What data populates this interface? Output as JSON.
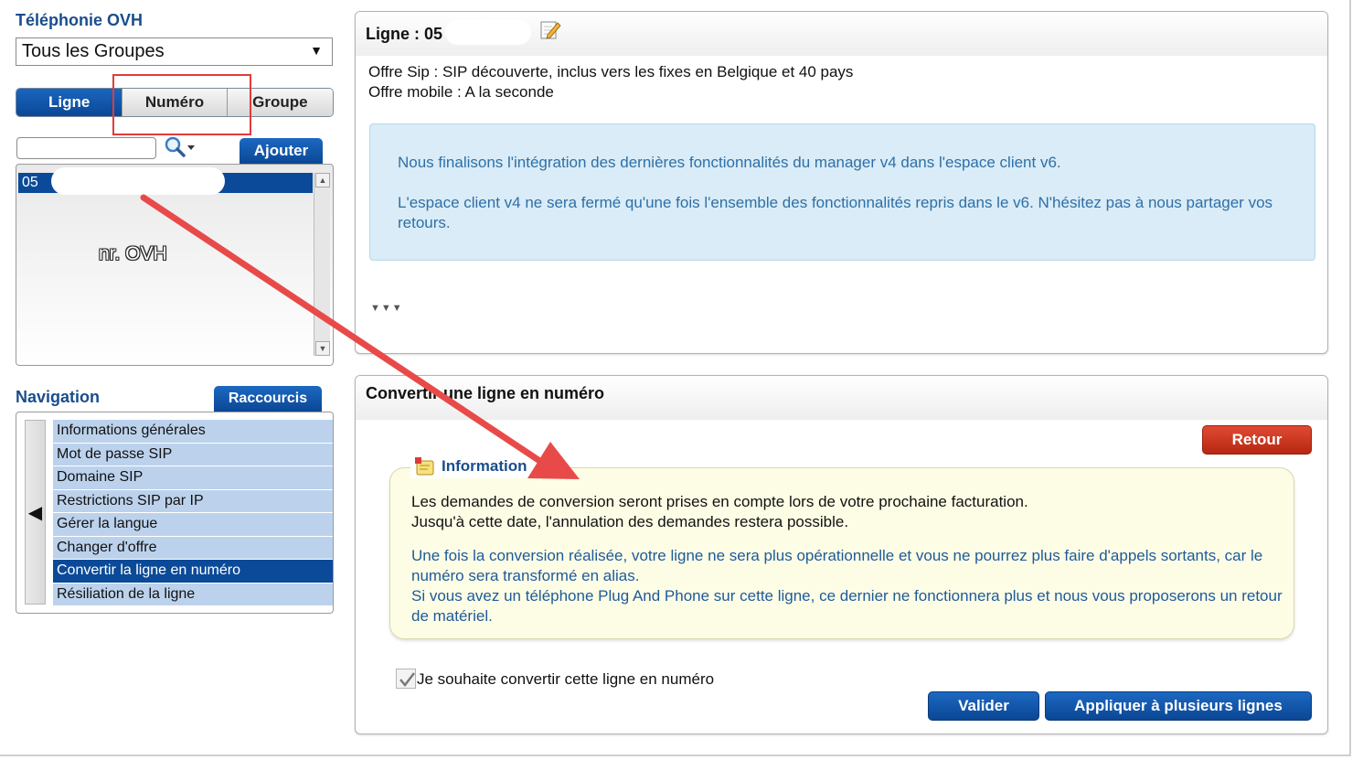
{
  "sidebar": {
    "title": "Téléphonie OVH",
    "group_select": {
      "value": "Tous les Groupes",
      "arrow": "▼"
    },
    "tabs": [
      {
        "label": "Ligne",
        "active": true
      },
      {
        "label": "Numéro",
        "active": false
      },
      {
        "label": "Groupe",
        "active": false
      }
    ],
    "search": {
      "placeholder": "",
      "icon": "search-icon"
    },
    "add_label": "Ajouter",
    "line_list": {
      "selected_prefix": "05",
      "annotation": "nr. OVH"
    }
  },
  "navigation": {
    "title": "Navigation",
    "shortcuts_label": "Raccourcis",
    "items": [
      "Informations générales",
      "Mot de passe SIP",
      "Domaine SIP",
      "Restrictions SIP par IP",
      "Gérer la langue",
      "Changer d'offre",
      "Convertir la ligne en numéro",
      "Résiliation de la ligne"
    ],
    "active_index": 6
  },
  "line_panel": {
    "title": "Ligne : 05",
    "offer_sip": "Offre Sip : SIP découverte, inclus vers les fixes en Belgique et 40 pays",
    "offer_mobile": "Offre mobile : A la seconde",
    "info_line1": "Nous finalisons l'intégration des dernières fonctionnalités du manager v4 dans l'espace client v6.",
    "info_line2": "L'espace client v4 ne sera fermé qu'une fois l'ensemble des fonctionnalités repris dans le v6. N'hésitez pas à nous partager vos retours.",
    "expand_glyph": "▼▼▼"
  },
  "convert_panel": {
    "title": "Convertir une ligne en numéro",
    "back_label": "Retour",
    "info_title": "Information",
    "info_p1_line1": "Les demandes de conversion seront prises en compte lors de votre prochaine facturation.",
    "info_p1_line2": "Jusqu'à cette date, l'annulation des demandes restera possible.",
    "info_p2_line1": "Une fois la conversion réalisée, votre ligne ne sera plus opérationnelle et vous ne pourrez plus faire d'appels sortants, car le numéro sera transformé en alias.",
    "info_p2_line2": "Si vous avez un téléphone Plug And Phone sur cette ligne, ce dernier ne fonctionnera plus et nous vous proposerons un retour de matériel.",
    "checkbox_label": "Je souhaite convertir cette ligne en numéro",
    "checkbox_checked": true,
    "validate_label": "Valider",
    "apply_multi_label": "Appliquer à plusieurs lignes"
  },
  "colors": {
    "primary_blue": "#0b4a98",
    "title_blue": "#1a4d8c",
    "nav_item_bg": "#bcd2ec",
    "info_bg": "#d9ecf7",
    "notice_bg": "#fdfde6",
    "back_red": "#c8341c",
    "annotation_red": "#e23b3b"
  }
}
